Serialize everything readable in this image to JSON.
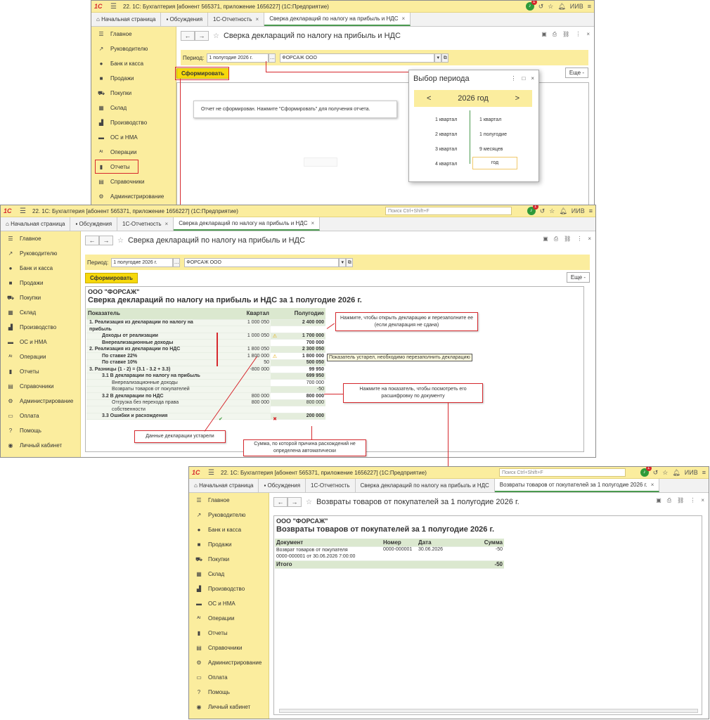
{
  "win1": {
    "title": "22. 1С: Бухгалтерия [абонент 565371, приложение 1656227]  (1С:Предприятие)",
    "search_placeholder": "Поиск Ctrl+Shift+F",
    "user": "ИИВ",
    "notif_count": "1",
    "tabs": [
      {
        "label": "Начальная страница"
      },
      {
        "label": "Обсуждения"
      },
      {
        "label": "1С-Отчетность"
      },
      {
        "label": "Сверка деклараций по налогу на прибыль и НДС"
      }
    ],
    "sidebar": [
      {
        "label": "Главное",
        "icon": "menu-icon"
      },
      {
        "label": "Руководителю",
        "icon": "trend-icon"
      },
      {
        "label": "Банк и касса",
        "icon": "coin-icon"
      },
      {
        "label": "Продажи",
        "icon": "bag-icon"
      },
      {
        "label": "Покупки",
        "icon": "cart-icon"
      },
      {
        "label": "Склад",
        "icon": "warehouse-icon"
      },
      {
        "label": "Производство",
        "icon": "factory-icon"
      },
      {
        "label": "ОС и НМА",
        "icon": "truck-icon"
      },
      {
        "label": "Операции",
        "icon": "operations-icon"
      },
      {
        "label": "Отчеты",
        "icon": "chart-icon"
      },
      {
        "label": "Справочники",
        "icon": "book-icon"
      },
      {
        "label": "Администрирование",
        "icon": "gear-icon"
      }
    ],
    "doc_title": "Сверка деклараций по налогу на прибыль и НДС",
    "period_label": "Период:",
    "period_value": "1 полугодие 2026 г.",
    "org_value": "ФОРСАЖ ООО",
    "form_button": "Сформировать",
    "more_button": "Еще -",
    "not_formed_msg": "Отчет не сформирован. Нажмите \"Сформировать\" для получения отчета.",
    "popup": {
      "title": "Выбор периода",
      "year": "2026 год",
      "prev": "<",
      "next": ">",
      "left": [
        "1 квартал",
        "2 квартал",
        "3 квартал",
        "4 квартал"
      ],
      "right": [
        "1 квартал",
        "1 полугодие",
        "9 месяцев",
        "год"
      ]
    }
  },
  "win2": {
    "title": "22. 1С: Бухгалтерия [абонент 565371, приложение 1656227]  (1С:Предприятие)",
    "search_placeholder": "Поиск Ctrl+Shift+F",
    "user": "ИИВ",
    "notif_count": "1",
    "tabs": [
      {
        "label": "Начальная страница"
      },
      {
        "label": "Обсуждения"
      },
      {
        "label": "1С-Отчетность"
      },
      {
        "label": "Сверка деклараций по налогу на прибыль и НДС"
      }
    ],
    "sidebar": [
      {
        "label": "Главное",
        "icon": "menu-icon"
      },
      {
        "label": "Руководителю",
        "icon": "trend-icon"
      },
      {
        "label": "Банк и касса",
        "icon": "coin-icon"
      },
      {
        "label": "Продажи",
        "icon": "bag-icon"
      },
      {
        "label": "Покупки",
        "icon": "cart-icon"
      },
      {
        "label": "Склад",
        "icon": "warehouse-icon"
      },
      {
        "label": "Производство",
        "icon": "factory-icon"
      },
      {
        "label": "ОС и НМА",
        "icon": "truck-icon"
      },
      {
        "label": "Операции",
        "icon": "operations-icon"
      },
      {
        "label": "Отчеты",
        "icon": "chart-icon"
      },
      {
        "label": "Справочники",
        "icon": "book-icon"
      },
      {
        "label": "Администрирование",
        "icon": "gear-icon"
      },
      {
        "label": "Оплата",
        "icon": "payment-icon"
      },
      {
        "label": "Помощь",
        "icon": "help-icon"
      },
      {
        "label": "Личный кабинет",
        "icon": "account-icon"
      }
    ],
    "doc_title": "Сверка деклараций по налогу на прибыль и НДС",
    "period_label": "Период:",
    "period_value": "1 полугодие 2026 г.",
    "org_value": "ФОРСАЖ ООО",
    "form_button": "Сформировать",
    "more_button": "Еще -",
    "report_org": "ООО \"ФОРСАЖ\"",
    "report_title": "Сверка деклараций по налогу на прибыль и НДС за 1 полугодие 2026 г.",
    "table_headers": [
      "Показатель",
      "Квартал",
      "Полугодие"
    ],
    "rows": [
      {
        "label": "1. Реализация из декларации по налогу на",
        "q": "1 000 050",
        "h": "2 400 000",
        "bold": true,
        "indent": 1
      },
      {
        "label": "прибыль",
        "q": "",
        "h": "",
        "bold": true,
        "indent": 1
      },
      {
        "label": "Доходы от реализации",
        "q": "1 000 050",
        "h": "1 700 000",
        "bold": true,
        "indent": 2,
        "warn": true,
        "mark": true
      },
      {
        "label": "Внереализационные доходы",
        "q": "",
        "h": "700 000",
        "bold": true,
        "indent": 2,
        "mark": true
      },
      {
        "label": "2. Реализация из декларации по НДС",
        "q": "1 800 050",
        "h": "2 300 050",
        "bold": true,
        "indent": 1,
        "mark": true
      },
      {
        "label": "По ставке 22%",
        "q": "1 800 000",
        "h": "1 800 000",
        "bold": true,
        "indent": 2,
        "warn": true,
        "mark": true
      },
      {
        "label": "По ставке 10%",
        "q": "50",
        "h": "500 050",
        "bold": true,
        "indent": 2,
        "mark": true
      },
      {
        "label": "3. Разницы (1 - 2) = (3.1 - 3.2 + 3.3)",
        "q": "-800 000",
        "h": "99 950",
        "bold": true,
        "indent": 1
      },
      {
        "label": "3.1 В декларации по налогу на прибыль",
        "q": "",
        "h": "699 950",
        "bold": true,
        "indent": 2
      },
      {
        "label": "Внереализационные доходы",
        "q": "",
        "h": "700 000",
        "bold": false,
        "indent": 3
      },
      {
        "label": "Возвраты товаров от покупателей",
        "q": "",
        "h": "-50",
        "bold": false,
        "indent": 3
      },
      {
        "label": "3.2 В декларации по НДС",
        "q": "800 000",
        "h": "800 000",
        "bold": true,
        "indent": 2
      },
      {
        "label": "Отгрузка без перехода права",
        "q": "800 000",
        "h": "800 000",
        "bold": false,
        "indent": 3
      },
      {
        "label": "собственности",
        "q": "",
        "h": "",
        "bold": false,
        "indent": 3
      },
      {
        "label": "3.3 Ошибки и расхождения",
        "q": "",
        "h": "200 000",
        "bold": true,
        "indent": 2,
        "check": true,
        "cross": true
      }
    ],
    "tooltip": "Показатель устарел, необходимо перезаполнить декларацию",
    "callouts": {
      "open_decl": "Нажмите, чтобы открыть декларацию и перезаполните ее (если декларация не сдана)",
      "click_indicator": "Нажмите на показатель, чтобы посмотреть его расшифровку по документу",
      "outdated": "Данные декларации устарели",
      "sum_auto": "Сумма, по которой причина расхождений не определена автоматически"
    }
  },
  "win3": {
    "title": "22. 1С: Бухгалтерия [абонент 565371, приложение 1656227]  (1С:Предприятие)",
    "search_placeholder": "Поиск Ctrl+Shift+F",
    "user": "ИИВ",
    "notif_count": "1",
    "tabs": [
      {
        "label": "Начальная страница"
      },
      {
        "label": "Обсуждения"
      },
      {
        "label": "1С-Отчетность"
      },
      {
        "label": "Сверка деклараций по налогу на прибыль и НДС"
      },
      {
        "label": "Возвраты товаров от покупателей за 1 полугодие 2026 г."
      }
    ],
    "sidebar": [
      {
        "label": "Главное",
        "icon": "menu-icon"
      },
      {
        "label": "Руководителю",
        "icon": "trend-icon"
      },
      {
        "label": "Банк и касса",
        "icon": "coin-icon"
      },
      {
        "label": "Продажи",
        "icon": "bag-icon"
      },
      {
        "label": "Покупки",
        "icon": "cart-icon"
      },
      {
        "label": "Склад",
        "icon": "warehouse-icon"
      },
      {
        "label": "Производство",
        "icon": "factory-icon"
      },
      {
        "label": "ОС и НМА",
        "icon": "truck-icon"
      },
      {
        "label": "Операции",
        "icon": "operations-icon"
      },
      {
        "label": "Отчеты",
        "icon": "chart-icon"
      },
      {
        "label": "Справочники",
        "icon": "book-icon"
      },
      {
        "label": "Администрирование",
        "icon": "gear-icon"
      },
      {
        "label": "Оплата",
        "icon": "payment-icon"
      },
      {
        "label": "Помощь",
        "icon": "help-icon"
      },
      {
        "label": "Личный кабинет",
        "icon": "account-icon"
      }
    ],
    "doc_title": "Возвраты товаров от покупателей за 1 полугодие 2026 г.",
    "report_org": "ООО \"ФОРСАЖ\"",
    "report_title": "Возвраты товаров от покупателей за 1 полугодие 2026 г.",
    "table_headers": [
      "Документ",
      "Номер",
      "Дата",
      "Сумма"
    ],
    "row": {
      "doc_line1": "Возврат товаров от покупателя",
      "doc_line2": "0000-000001 от 30.06.2026 7:00:00",
      "number": "0000-000001",
      "date": "30.06.2026",
      "sum": "-50"
    },
    "total_label": "Итого",
    "total_value": "-50"
  },
  "colors": {
    "accent_yellow": "#fbed9e",
    "button_yellow": "#f6d80b",
    "annotation_red": "#d6282d",
    "table_header_green": "#dbe8cf",
    "brand_red": "#d6282d"
  }
}
